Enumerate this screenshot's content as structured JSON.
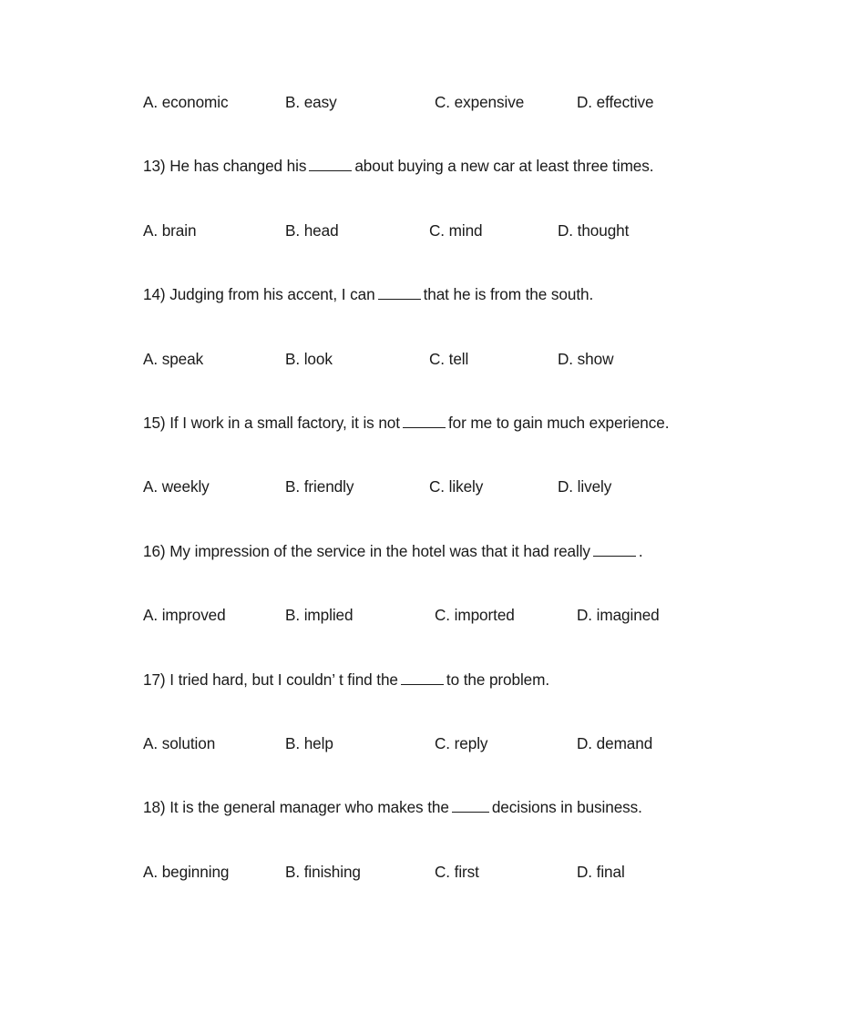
{
  "document": {
    "type": "exam-worksheet",
    "text_color": "#1a1a1a",
    "background_color": "#ffffff"
  },
  "blocks": [
    {
      "kind": "options",
      "name": "options-row-12",
      "a": "A. economic",
      "b": "B. easy",
      "c": "C. expensive",
      "d": "D. effective"
    },
    {
      "kind": "question",
      "name": "question-13",
      "number": "13)",
      "before": "13) He has changed his",
      "after": "about buying a new car at least three times.",
      "blank": "w5"
    },
    {
      "kind": "options",
      "name": "options-row-13",
      "a": "A. brain",
      "b": "B. head",
      "c": "C. mind",
      "d": "D. thought"
    },
    {
      "kind": "question",
      "name": "question-14",
      "number": "14)",
      "before": "14) Judging from his accent, I can",
      "after": "that he is from the south.",
      "blank": "w5"
    },
    {
      "kind": "options",
      "name": "options-row-14",
      "a": "A. speak",
      "b": "B. look",
      "c": "C. tell",
      "d": "D. show"
    },
    {
      "kind": "question",
      "name": "question-15",
      "number": "15)",
      "before": "15) If I work in a small factory, it is not",
      "after": "for me to gain much experience.",
      "blank": "w5"
    },
    {
      "kind": "options",
      "name": "options-row-15",
      "a": "A. weekly",
      "b": "B. friendly",
      "c": "C. likely",
      "d": "D. lively"
    },
    {
      "kind": "question",
      "name": "question-16",
      "number": "16)",
      "before": "16) My impression of the service in the hotel was that it had really",
      "after": ".",
      "blank": "w5"
    },
    {
      "kind": "options",
      "name": "options-row-16",
      "a": "A. improved",
      "b": "B. implied",
      "c": "C. imported",
      "d": "D. imagined"
    },
    {
      "kind": "question",
      "name": "question-17",
      "number": "17)",
      "before": "17) I tried hard, but I couldn’ t find the",
      "after": "to the problem.",
      "blank": "w5"
    },
    {
      "kind": "options",
      "name": "options-row-17",
      "a": "A. solution",
      "b": "B. help",
      "c": "C. reply",
      "d": "D. demand"
    },
    {
      "kind": "question",
      "name": "question-18",
      "number": "18)",
      "before": "18) It is the general manager who makes the",
      "after": "decisions in business.",
      "blank": "w4"
    },
    {
      "kind": "options",
      "name": "options-row-18",
      "a": "A. beginning",
      "b": "B. finishing",
      "c": "C. first",
      "d": "D. final"
    }
  ]
}
